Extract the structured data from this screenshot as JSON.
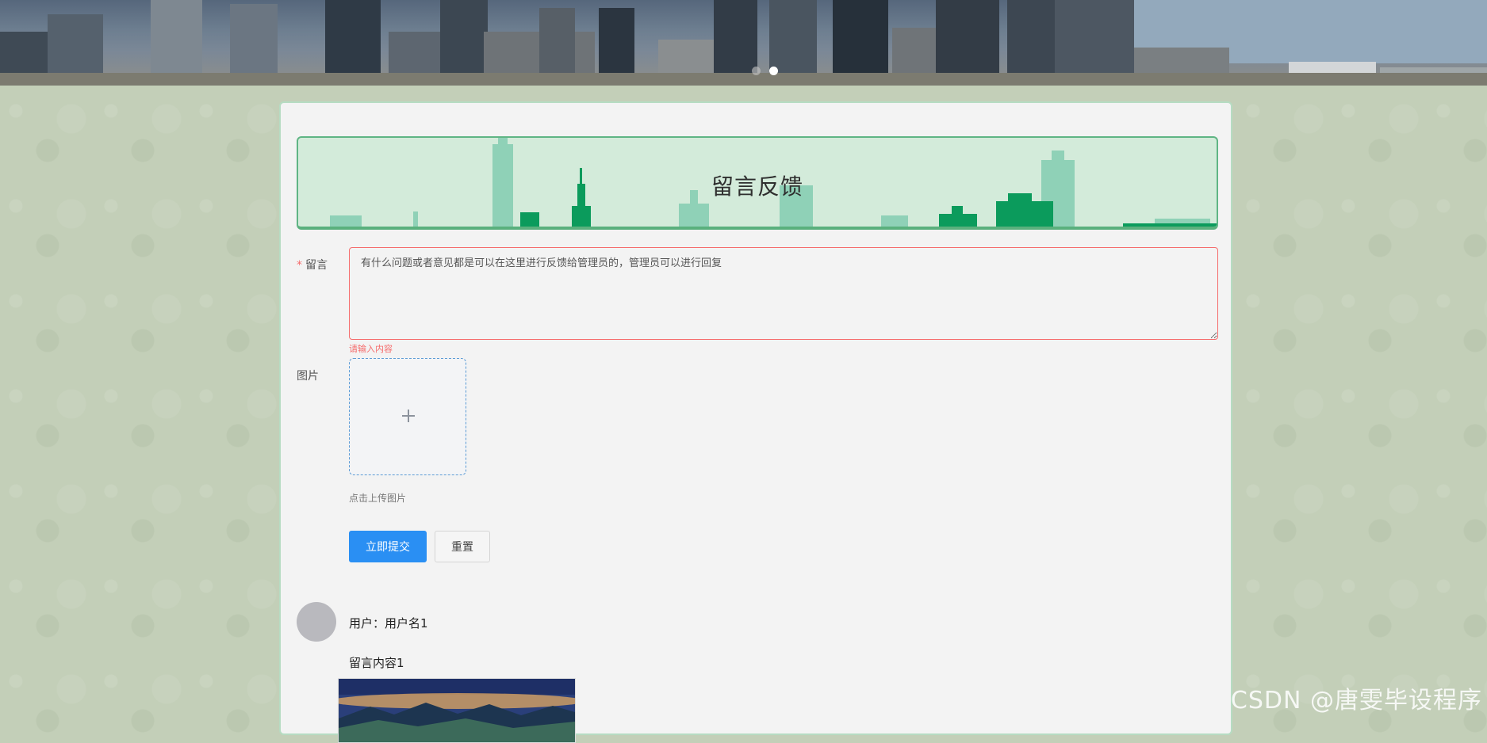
{
  "form": {
    "title": "留言反馈",
    "message_label": "留言",
    "required_mark": "*",
    "message_value": "有什么问题或者意见都是可以在这里进行反馈给管理员的，管理员可以进行回复",
    "message_error": "请输入内容",
    "image_label": "图片",
    "upload_tip": "点击上传图片",
    "submit_label": "立即提交",
    "reset_label": "重置"
  },
  "comments": [
    {
      "user": "用户：用户名1",
      "content": "留言内容1"
    }
  ],
  "carousel": {
    "active_slide": 2,
    "slide_count": 2
  },
  "watermark": "CSDN @唐雯毕设程序",
  "colors": {
    "primary": "#2a8ff3",
    "error": "#f56c6c",
    "title_bg": "#d3ebda",
    "title_border": "#5fb584",
    "skyline": "#0b9b5c",
    "page_bg": "#c3cfb8"
  },
  "icons": {
    "upload": "plus-icon"
  }
}
